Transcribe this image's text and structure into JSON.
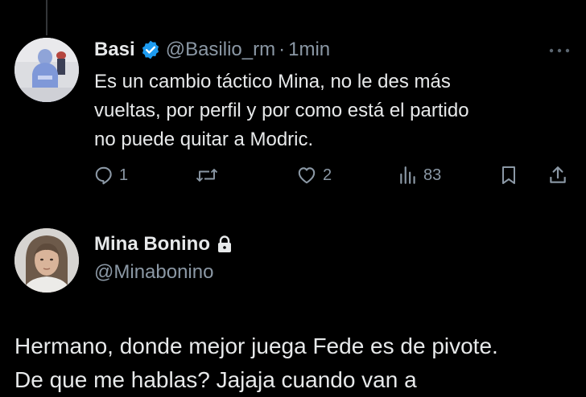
{
  "reply": {
    "author_name": "Basi",
    "handle": "@Basilio_rm",
    "separator": "·",
    "time": "1min",
    "text_lines": [
      "Es un cambio táctico Mina, no le des más",
      "vueltas, por perfil y por como está el partido",
      "no puede quitar a Modric."
    ],
    "actions": {
      "replies": "1",
      "reposts": "",
      "likes": "2",
      "views": "83"
    }
  },
  "main": {
    "author_name": "Mina Bonino",
    "handle": "@Minabonino",
    "text_lines": [
      "Hermano, donde mejor juega Fede es de pivote.",
      "De que me hablas? Jajaja cuando van a"
    ]
  },
  "colors": {
    "background": "#000000",
    "text_primary": "#e7e9ea",
    "text_secondary": "#8b98a5",
    "verified_blue": "#1d9bf0"
  },
  "icons": {
    "verified": "verified-badge-icon",
    "more": "more-dots-icon",
    "reply": "reply-bubble-icon",
    "repost": "repost-icon",
    "like": "heart-icon",
    "views": "views-chart-icon",
    "bookmark": "bookmark-icon",
    "share": "share-upload-icon",
    "lock": "lock-icon"
  }
}
